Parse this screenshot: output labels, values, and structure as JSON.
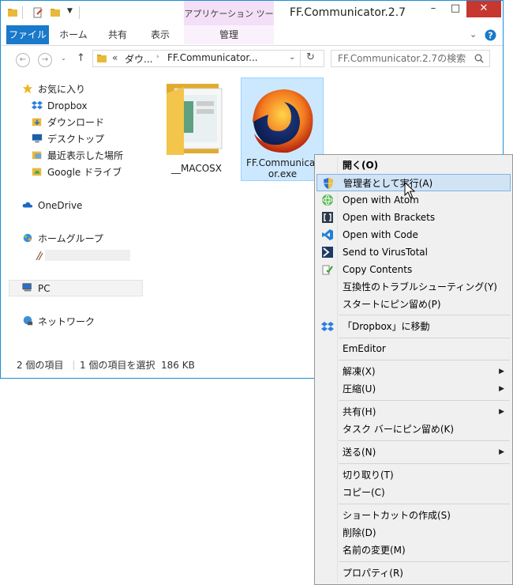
{
  "window": {
    "title": "FF.Communicator.2.7",
    "context_tab_title": "アプリケーション ツール",
    "controls": {
      "minimize": "–",
      "maximize": "□",
      "close": "✕"
    }
  },
  "ribbon": {
    "tabs": [
      {
        "label": "ファイル"
      },
      {
        "label": "ホーム"
      },
      {
        "label": "共有"
      },
      {
        "label": "表示"
      },
      {
        "label": "管理"
      }
    ]
  },
  "address": {
    "chevrons": "«",
    "crumb1": "ダウ...",
    "crumb2": "FF.Communicator...",
    "search_placeholder": "FF.Communicator.2.7の検索"
  },
  "nav": {
    "favorites": "お気に入り",
    "dropbox": "Dropbox",
    "downloads": "ダウンロード",
    "desktop": "デスクトップ",
    "recent": "最近表示した場所",
    "gdrive": "Google ドライブ",
    "onedrive": "OneDrive",
    "homegroup": "ホームグループ",
    "pc": "PC",
    "network": "ネットワーク"
  },
  "files": [
    {
      "name": "__MACOSX",
      "type": "folder"
    },
    {
      "name_line1": "FF.Communicat",
      "name_line2": "or.exe",
      "type": "exe",
      "selected": true
    }
  ],
  "status": {
    "count": "2 個の項目",
    "selected": "1 個の項目を選択",
    "size": "186 KB"
  },
  "context_menu": {
    "open": "開く(O)",
    "run_as_admin": "管理者として実行(A)",
    "open_atom": "Open with Atom",
    "open_brackets": "Open with Brackets",
    "open_code": "Open with Code",
    "virustotal": "Send to VirusTotal",
    "copy_contents": "Copy Contents",
    "compat": "互換性のトラブルシューティング(Y)",
    "pin_start": "スタートにピン留め(P)",
    "move_dropbox": "「Dropbox」に移動",
    "emeditor": "EmEditor",
    "extract": "解凍(X)",
    "compress": "圧縮(U)",
    "share": "共有(H)",
    "pin_taskbar": "タスク バーにピン留め(K)",
    "sendto": "送る(N)",
    "cut": "切り取り(T)",
    "copy": "コピー(C)",
    "shortcut": "ショートカットの作成(S)",
    "delete": "削除(D)",
    "rename": "名前の変更(M)",
    "properties": "プロパティ(R)",
    "submenu_arrow": "▶"
  },
  "colors": {
    "accent": "#1979ca",
    "context_tab": "#f3dff7",
    "close": "#c7362f",
    "selection": "#cce8ff",
    "menu_hover": "#d1e4f6"
  }
}
